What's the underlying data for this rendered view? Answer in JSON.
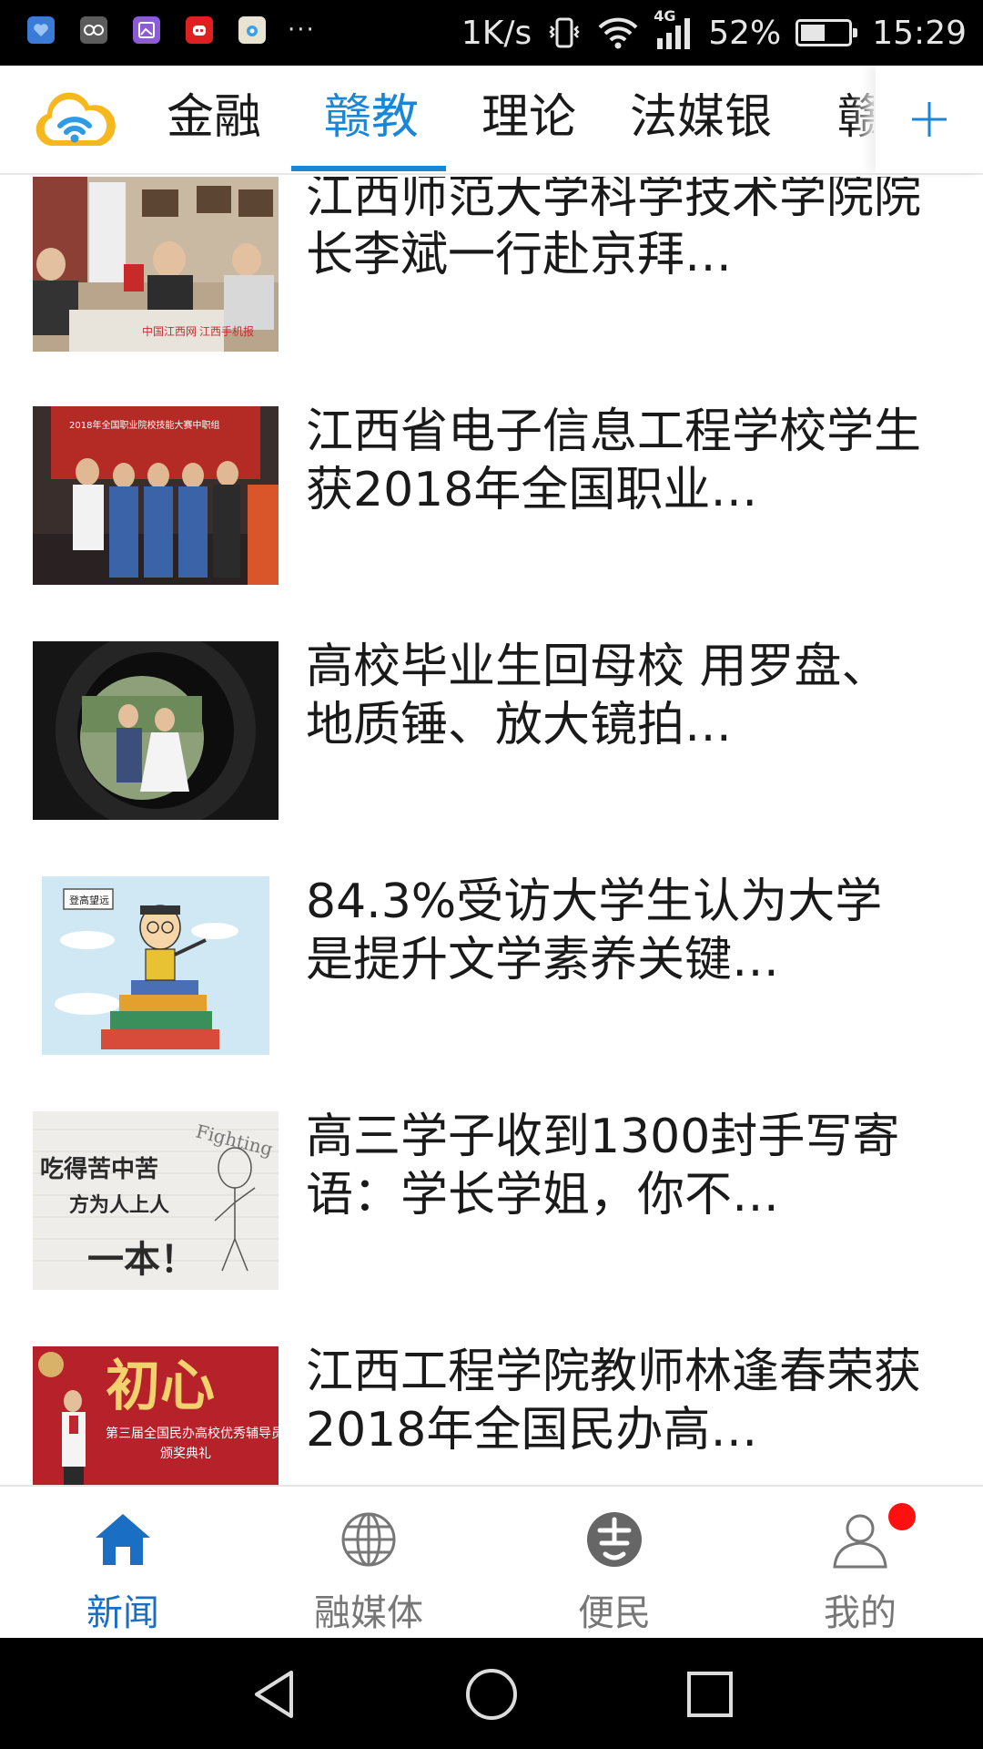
{
  "status_bar": {
    "dots": "···",
    "speed": "1K/s",
    "network": "4G",
    "battery_percent": "52%",
    "battery_level": 0.52,
    "time": "15:29"
  },
  "header": {
    "tabs": [
      {
        "label": "金融",
        "active": false
      },
      {
        "label": "赣教",
        "active": true
      },
      {
        "label": "理论",
        "active": false
      },
      {
        "label": "法媒银",
        "active": false
      },
      {
        "label": "赣",
        "active": false
      }
    ],
    "add_icon": "plus-icon"
  },
  "news": [
    {
      "title": "江西师范大学科学技术学院院长李斌一行赴京拜…",
      "watermark": "中国江西网 江西手机报"
    },
    {
      "title": "江西省电子信息工程学校学生获2018年全国职业…",
      "banner": "2018年全国职业院校技能大赛中职组"
    },
    {
      "title": "高校毕业生回母校 用罗盘、地质锤、放大镜拍…"
    },
    {
      "title": "84.3%受访大学生认为大学是提升文学素养关键…",
      "sign": "登高望远"
    },
    {
      "title": "高三学子收到1300封手写寄语：学长学姐，你不…",
      "handwriting": [
        "吃得苦中苦",
        "方为人上人",
        "一本！"
      ],
      "corner_text": "Fighting"
    },
    {
      "title": "江西工程学院教师林逢春荣获2018年全国民办高…",
      "poster_title": "初心",
      "poster_sub": "第三届全国民办高校优秀辅导员",
      "poster_sub2": "颁奖典礼"
    }
  ],
  "bottom_nav": [
    {
      "label": "新闻",
      "icon": "home-icon",
      "active": true
    },
    {
      "label": "融媒体",
      "icon": "globe-icon",
      "active": false
    },
    {
      "label": "便民",
      "icon": "service-icon",
      "active": false
    },
    {
      "label": "我的",
      "icon": "user-icon",
      "active": false,
      "badge": true
    }
  ],
  "colors": {
    "accent": "#1a86d6",
    "active_nav": "#1a6fc4",
    "badge": "#ff1010"
  }
}
